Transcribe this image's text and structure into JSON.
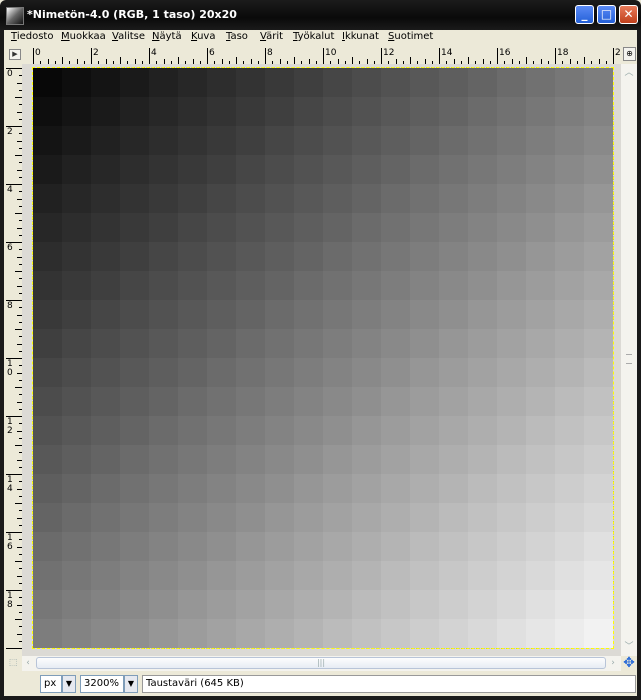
{
  "window": {
    "title": "*Nimetön-4.0 (RGB, 1 taso) 20x20",
    "buttons": {
      "minimize": "_",
      "maximize": "□",
      "close": "✕"
    }
  },
  "menubar": {
    "items": [
      "Tiedosto",
      "Muokkaa",
      "Valitse",
      "Näytä",
      "Kuva",
      "Taso",
      "Värit",
      "Työkalut",
      "Ikkunat",
      "Suotimet"
    ]
  },
  "rulers": {
    "horizontal_labels": [
      "0",
      "2",
      "4",
      "6",
      "8",
      "10",
      "12",
      "14",
      "16",
      "18",
      "2"
    ],
    "vertical_labels": [
      "0",
      "2",
      "4",
      "6",
      "8",
      "10",
      "12",
      "14",
      "16",
      "18"
    ]
  },
  "canvas": {
    "image_width": 20,
    "image_height": 20,
    "gradient_start_color": "#080808",
    "gradient_end_color": "#f2f2f2"
  },
  "statusbar": {
    "unit": "px",
    "zoom": "3200%",
    "message": "Taustaväri (645 KB)"
  }
}
